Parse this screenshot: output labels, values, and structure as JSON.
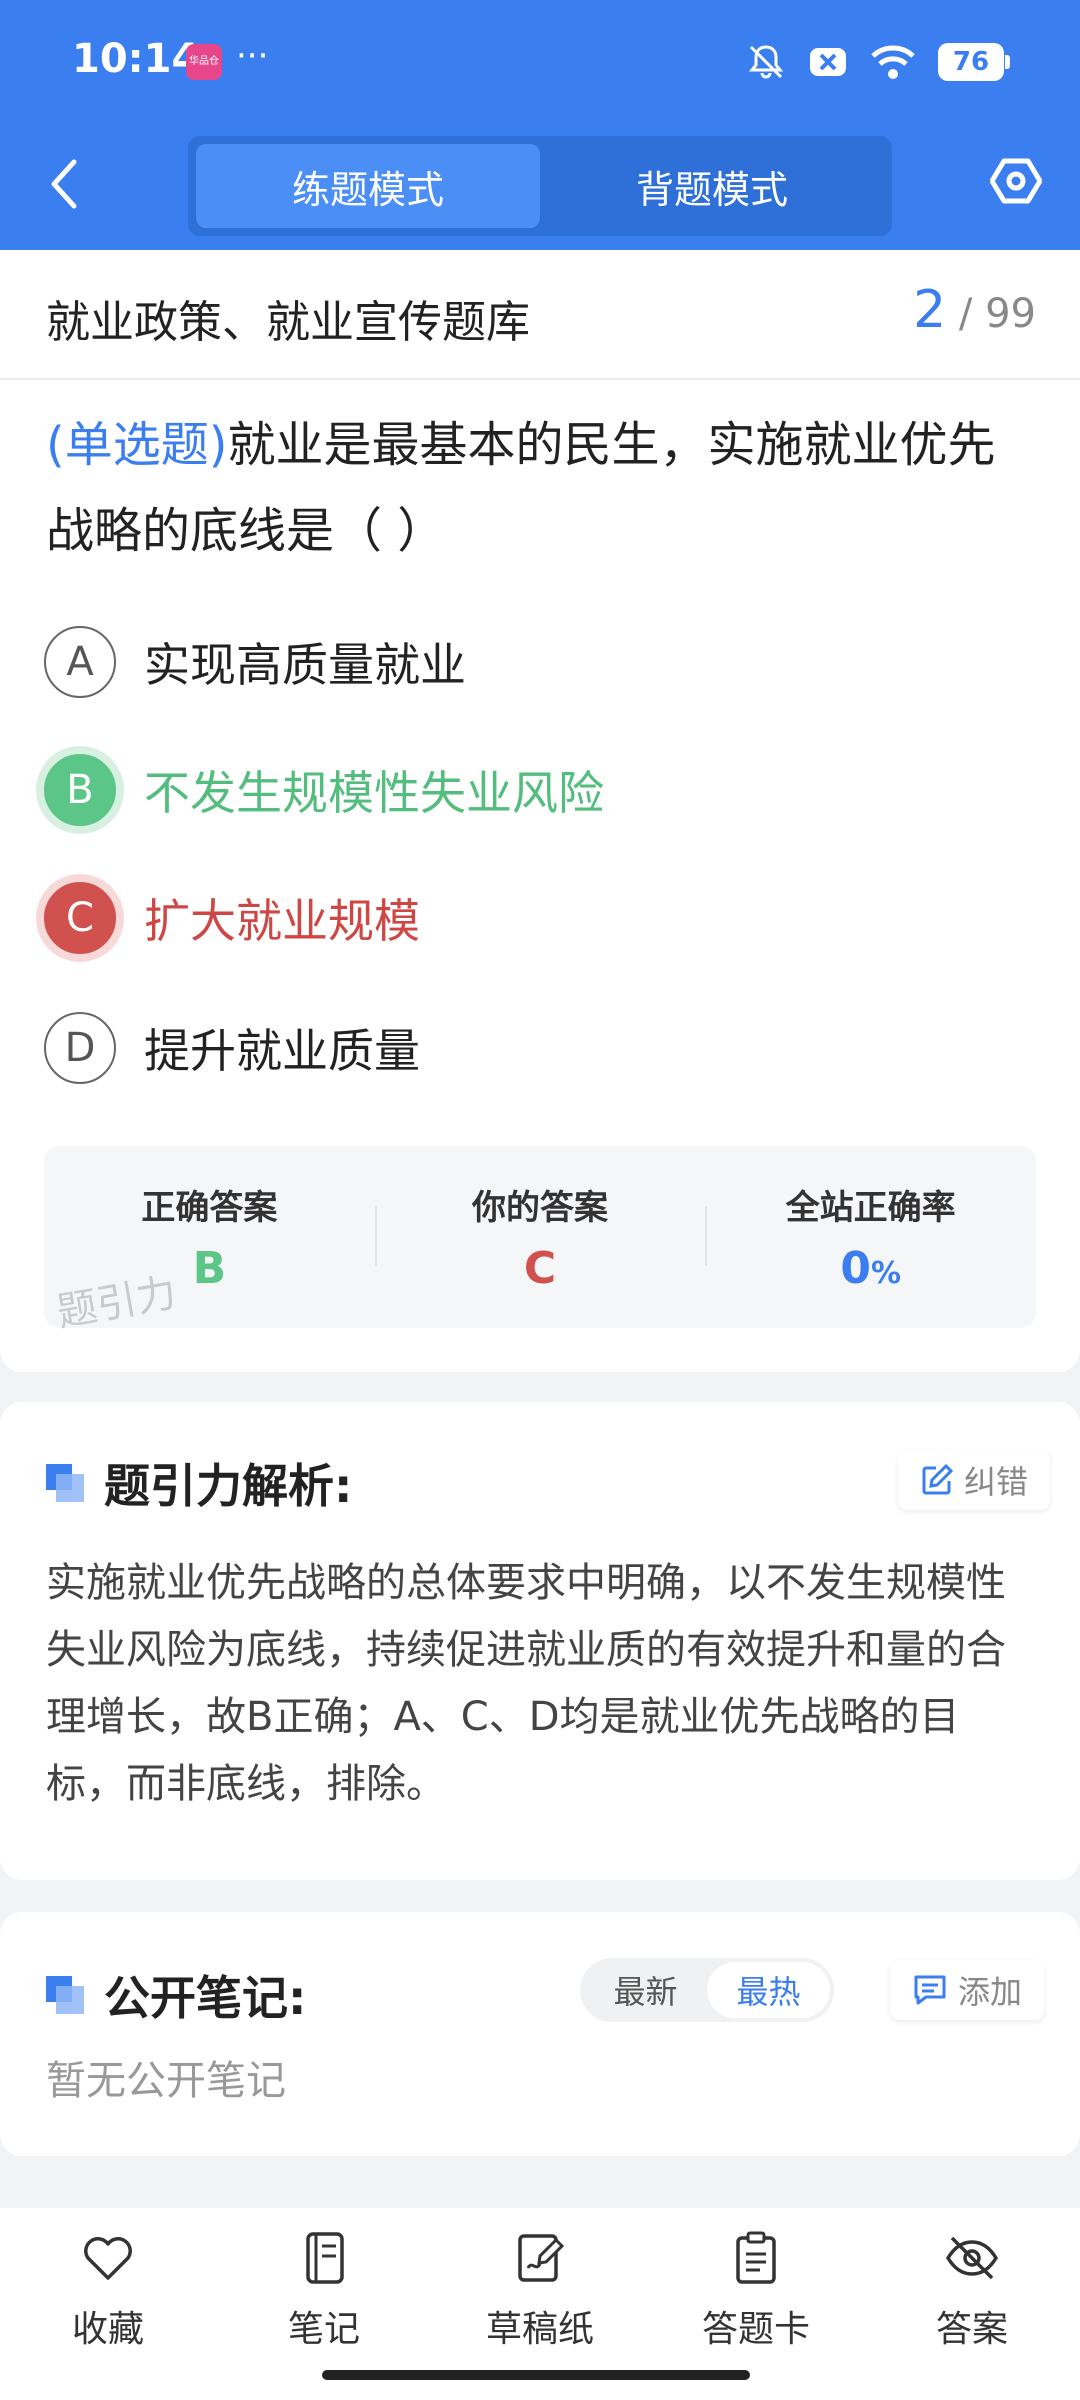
{
  "status_bar": {
    "time": "10:14",
    "app_icon_text": "华品仓",
    "dots": "···",
    "battery": "76"
  },
  "header": {
    "tabs": [
      {
        "label": "练题模式",
        "active": true
      },
      {
        "label": "背题模式",
        "active": false
      }
    ]
  },
  "bank": {
    "title": "就业政策、就业宣传题库",
    "current": "2",
    "total": "/ 99"
  },
  "question": {
    "type": "(单选题)",
    "text": "就业是最基本的民生，实施就业优先战略的底线是（        ）"
  },
  "options": [
    {
      "letter": "A",
      "text": "实现高质量就业",
      "state": "normal"
    },
    {
      "letter": "B",
      "text": "不发生规模性失业风险",
      "state": "correct"
    },
    {
      "letter": "C",
      "text": "扩大就业规模",
      "state": "wrong"
    },
    {
      "letter": "D",
      "text": "提升就业质量",
      "state": "normal"
    }
  ],
  "answer_summary": {
    "correct_label": "正确答案",
    "correct_value": "B",
    "yours_label": "你的答案",
    "yours_value": "C",
    "rate_label": "全站正确率",
    "rate_value": "0",
    "rate_unit": "%",
    "watermark": "题引力"
  },
  "analysis": {
    "title": "题引力解析:",
    "correct_button": "纠错",
    "text": "实施就业优先战略的总体要求中明确，以不发生规模性失业风险为底线，持续促进就业质的有效提升和量的合理增长，故B正确；A、C、D均是就业优先战略的目标，而非底线，排除。"
  },
  "notes": {
    "title": "公开笔记:",
    "sort_latest": "最新",
    "sort_hot": "最热",
    "add_button": "添加",
    "empty_text": "暂无公开笔记"
  },
  "bottom_nav": [
    {
      "label": "收藏",
      "icon": "heart-icon"
    },
    {
      "label": "笔记",
      "icon": "notebook-icon"
    },
    {
      "label": "草稿纸",
      "icon": "draft-paper-icon"
    },
    {
      "label": "答题卡",
      "icon": "answer-card-icon"
    },
    {
      "label": "答案",
      "icon": "eye-off-icon"
    }
  ],
  "colors": {
    "accent": "#3b7ef0",
    "correct": "#5cc689",
    "wrong": "#d0514d"
  }
}
